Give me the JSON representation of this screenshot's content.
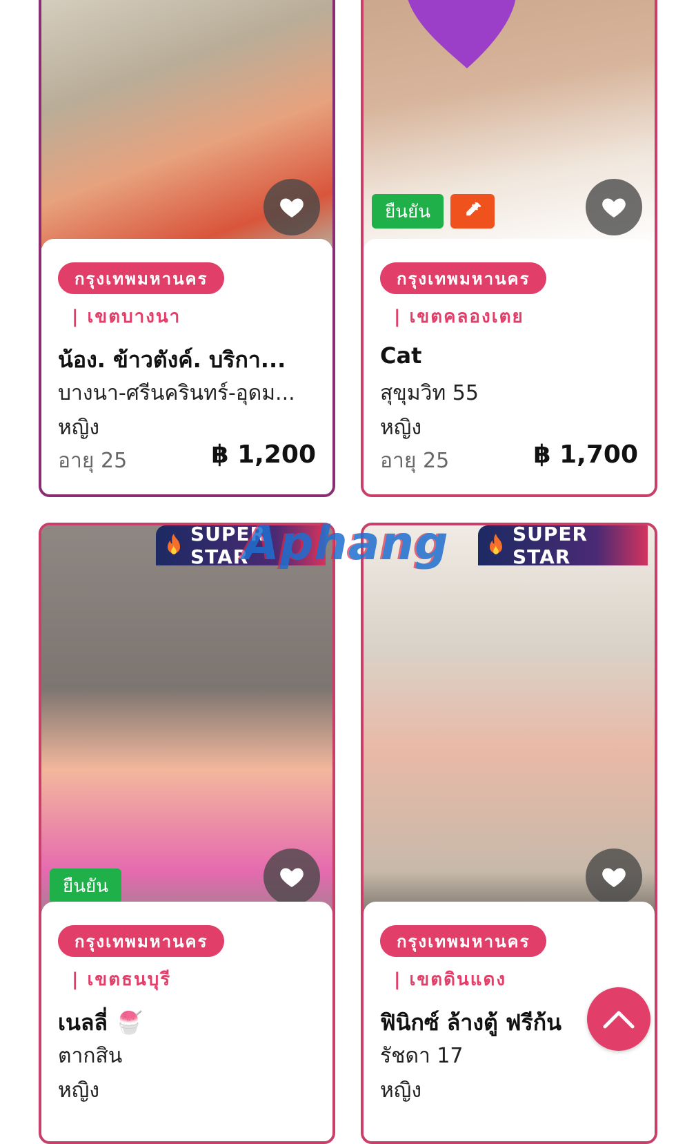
{
  "listings": [
    {
      "province": "กรุงเทพมหานคร",
      "district": "| เขตบางนา",
      "name": "น้อง. ข้าวตังค์. บริกา...",
      "area": "บางนา-ศรีนครินทร์-อุดม...",
      "gender": "หญิง",
      "age": "อายุ 25",
      "price": "฿ 1,200",
      "favorite_icon": "heart-icon"
    },
    {
      "province": "กรุงเทพมหานคร",
      "district": "| เขตคลองเตย",
      "name": "Cat",
      "area": "สุขุมวิท 55",
      "gender": "หญิง",
      "age": "อายุ 25",
      "price": "฿ 1,700",
      "badges": {
        "verified": "ยืนยัน",
        "vaccine_icon": "syringe-icon"
      },
      "favorite_icon": "heart-icon"
    },
    {
      "superstar": "SUPER STAR",
      "province": "กรุงเทพมหานคร",
      "district": "| เขตธนบุรี",
      "name": "เนลลี่ 🍧",
      "area": "ตากสิน",
      "gender": "หญิง",
      "badges": {
        "verified": "ยืนยัน"
      },
      "favorite_icon": "heart-icon"
    },
    {
      "superstar": "SUPER STAR",
      "province": "กรุงเทพมหานคร",
      "district": "| เขตดินแดง",
      "name": "ฟินิกซ์ ล้างตู้ ฟรีก้น",
      "area": "รัชดา 17",
      "gender": "หญิง",
      "favorite_icon": "heart-icon"
    }
  ],
  "watermark": "Aphang",
  "scroll_top_icon": "chevron-up-icon",
  "colors": {
    "accent": "#e13f69",
    "verified": "#1fb04a",
    "vaccine": "#f0521e",
    "superstar_start": "#1c2a63",
    "superstar_end": "#d3345e"
  }
}
